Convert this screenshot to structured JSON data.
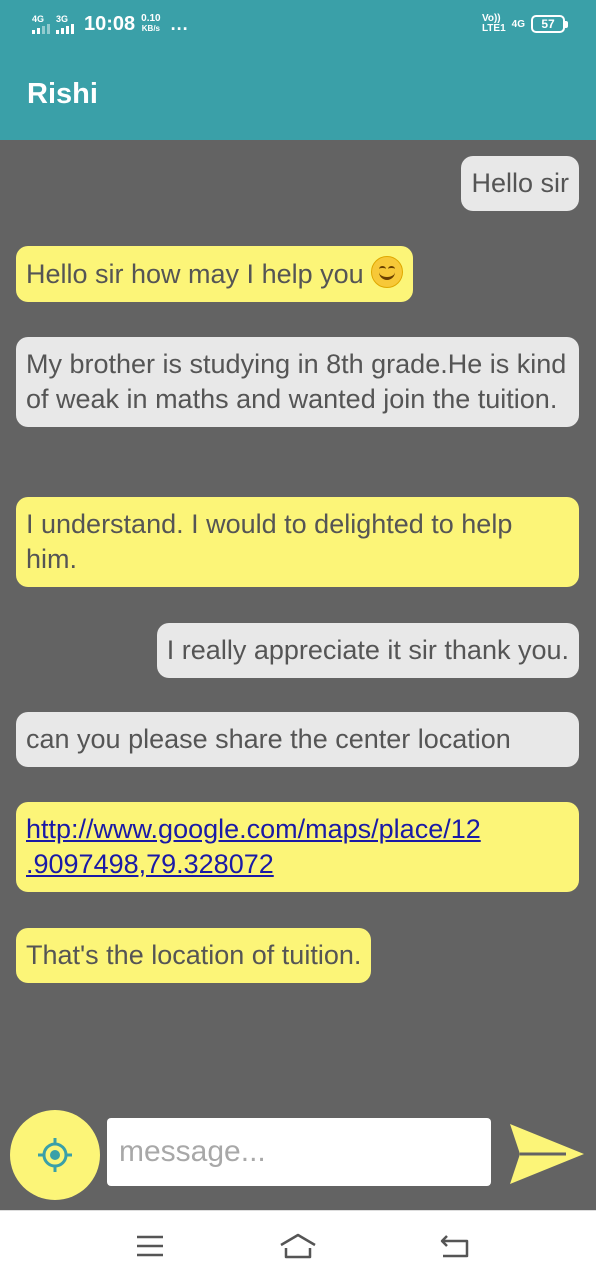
{
  "status_bar": {
    "net1": "4G",
    "net2": "3G",
    "time": "10:08",
    "speed_value": "0.10",
    "speed_unit": "KB/s",
    "more": "...",
    "volte_top": "Vo))",
    "volte_bottom": "LTE1",
    "net3": "4G",
    "battery": "57"
  },
  "header": {
    "title": "Rishi"
  },
  "messages": [
    {
      "type": "sent",
      "text": "Hello sir"
    },
    {
      "type": "received",
      "text": "Hello sir how may I help you",
      "emoji": "smiling-face-icon"
    },
    {
      "type": "sent",
      "text": "My brother is studying in 8th grade.He is kind of weak in maths and wanted join the tuition."
    },
    {
      "type": "received",
      "text": "I understand. I would to delighted to help him."
    },
    {
      "type": "sent",
      "text": "I really appreciate it sir thank you."
    },
    {
      "type": "sent",
      "text": "can you please share the center location"
    },
    {
      "type": "received",
      "text": "http://www.google.com/maps/place/12.9097498,79.328072",
      "line1": "http://www.google.com/maps/place/12",
      "line2": ".9097498,79.328072"
    },
    {
      "type": "received",
      "text": "That's the location of tuition."
    }
  ],
  "compose": {
    "placeholder": "message...",
    "location_icon": "crosshair-location-icon",
    "send_icon": "send-arrow-icon"
  },
  "nav": {
    "menu_icon": "menu-icon",
    "home_icon": "home-icon",
    "back_icon": "back-icon"
  },
  "colors": {
    "accent": "#3aa0a8",
    "background": "#636363",
    "sent_bubble": "#e8e8e8",
    "received_bubble": "#fcf578",
    "link": "#1a1aa6"
  }
}
